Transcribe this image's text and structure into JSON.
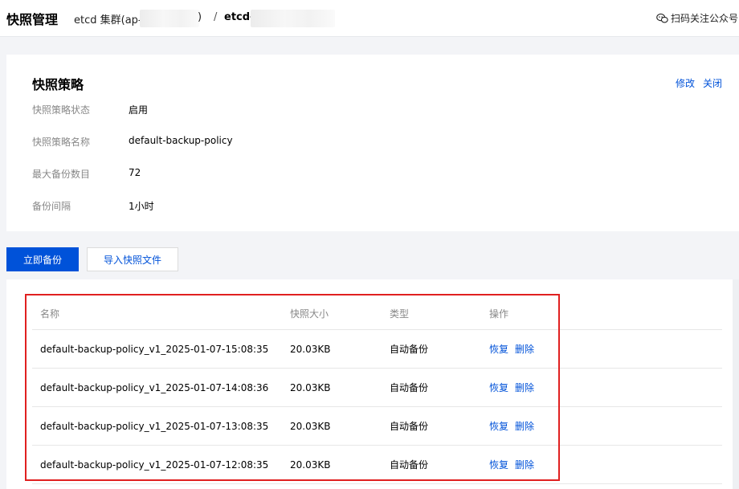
{
  "header": {
    "title": "快照管理",
    "crumb_cluster": "etcd 集群(ap-",
    "crumb_close_paren": ")",
    "crumb_sep": "/",
    "crumb_etcd": "etcd-",
    "wechat_label": "扫码关注公众号",
    "wechat_icon": "wechat-icon"
  },
  "policy": {
    "title": "快照策略",
    "edit_label": "修改",
    "close_label": "关闭",
    "fields": [
      {
        "label": "快照策略状态",
        "value": "启用"
      },
      {
        "label": "快照策略名称",
        "value": "default-backup-policy"
      },
      {
        "label": "最大备份数目",
        "value": "72"
      },
      {
        "label": "备份间隔",
        "value": "1小时"
      }
    ]
  },
  "actions": {
    "backup_now": "立即备份",
    "import_file": "导入快照文件"
  },
  "table": {
    "columns": [
      "名称",
      "快照大小",
      "类型",
      "操作"
    ],
    "rows": [
      {
        "name": "default-backup-policy_v1_2025-01-07-15:08:35",
        "size": "20.03KB",
        "type": "自动备份",
        "restore": "恢复",
        "delete": "删除"
      },
      {
        "name": "default-backup-policy_v1_2025-01-07-14:08:36",
        "size": "20.03KB",
        "type": "自动备份",
        "restore": "恢复",
        "delete": "删除"
      },
      {
        "name": "default-backup-policy_v1_2025-01-07-13:08:35",
        "size": "20.03KB",
        "type": "自动备份",
        "restore": "恢复",
        "delete": "删除"
      },
      {
        "name": "default-backup-policy_v1_2025-01-07-12:08:35",
        "size": "20.03KB",
        "type": "自动备份",
        "restore": "恢复",
        "delete": "删除"
      }
    ]
  },
  "colors": {
    "accent": "#0052d9",
    "highlight": "#e02020"
  }
}
